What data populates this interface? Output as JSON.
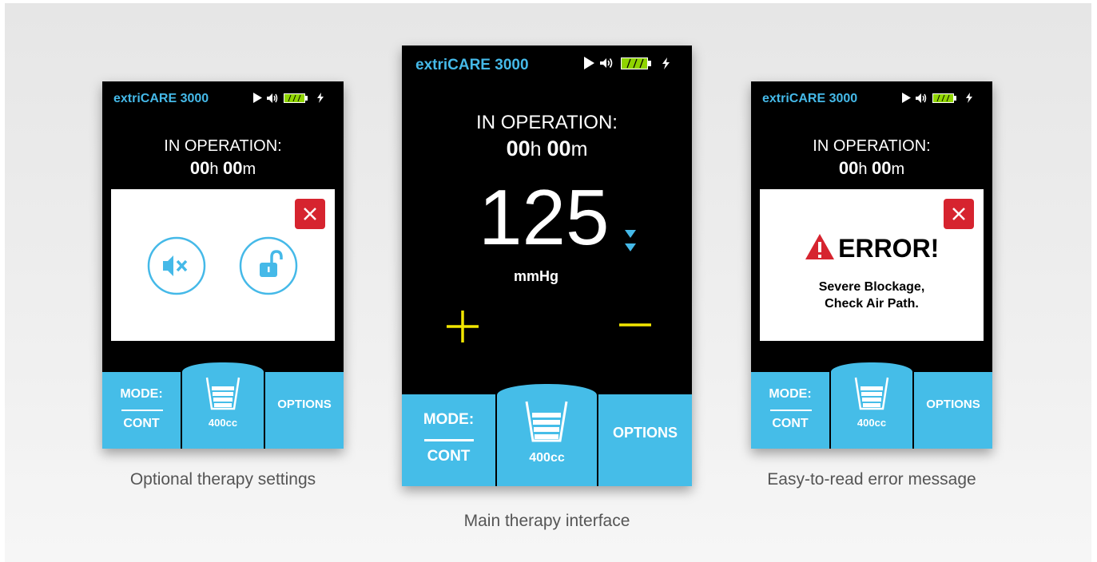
{
  "brand": "extriCARE 3000",
  "operation": {
    "label": "IN OPERATION:",
    "hours": "00",
    "hours_unit": "h",
    "minutes": "00",
    "minutes_unit": "m"
  },
  "bottom_bar": {
    "mode_label": "MODE:",
    "mode_value": "CONT",
    "canister_volume": "400cc",
    "options_label": "OPTIONS"
  },
  "main": {
    "pressure_value": "125",
    "pressure_unit": "mmHg",
    "plus_symbol": "+",
    "minus_symbol": "—"
  },
  "error": {
    "title": "ERROR!",
    "line1": "Severe Blockage,",
    "line2": "Check Air Path."
  },
  "captions": {
    "left": "Optional therapy settings",
    "center": "Main therapy interface",
    "right": "Easy-to-read error message"
  },
  "colors": {
    "brand": "#45b9e8",
    "tab_blue": "#45bde8",
    "accent_yellow": "#f2e600",
    "close_red": "#d6242f",
    "battery_green": "#8fd400"
  }
}
